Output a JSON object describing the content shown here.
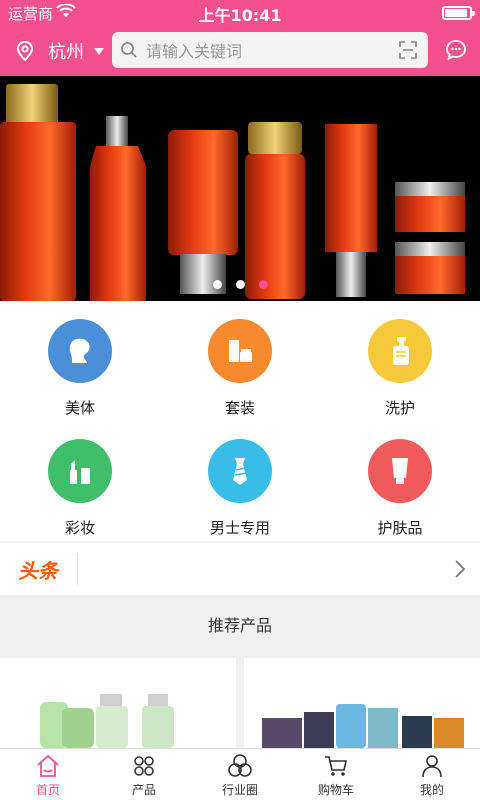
{
  "status_bar": {
    "carrier": "运营商",
    "time": "上午10:41"
  },
  "header": {
    "city": "杭州",
    "search_placeholder": "请输入关键词"
  },
  "banner": {
    "dots": 3,
    "active_dot": 3
  },
  "categories": [
    {
      "label": "美体",
      "color": "#4b8fd8",
      "icon": "body-icon"
    },
    {
      "label": "套装",
      "color": "#f58b2e",
      "icon": "set-icon"
    },
    {
      "label": "洗护",
      "color": "#f7c93a",
      "icon": "bottle-icon"
    },
    {
      "label": "彩妆",
      "color": "#3fbf6a",
      "icon": "lipstick-icon"
    },
    {
      "label": "男士专用",
      "color": "#37bde8",
      "icon": "tie-icon"
    },
    {
      "label": "护肤品",
      "color": "#f15a5a",
      "icon": "tube-icon"
    }
  ],
  "news": {
    "logo": "头条"
  },
  "recommend": {
    "title": "推荐产品"
  },
  "tabbar": {
    "items": [
      {
        "label": "首页",
        "active": true
      },
      {
        "label": "产品",
        "active": false
      },
      {
        "label": "行业圈",
        "active": false
      },
      {
        "label": "购物车",
        "active": false
      },
      {
        "label": "我的",
        "active": false
      }
    ]
  },
  "colors": {
    "brand": "#f2508e",
    "news_logo": "#ff5a00"
  }
}
